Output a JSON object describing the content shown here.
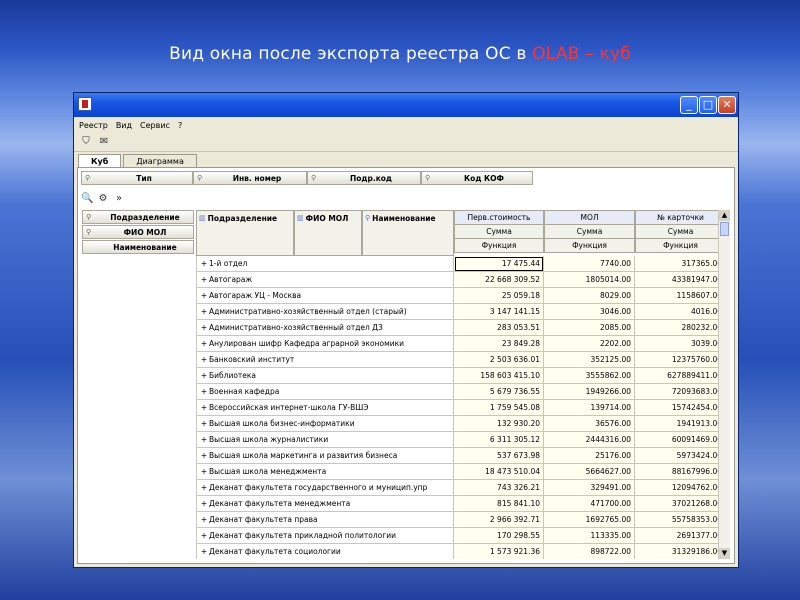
{
  "slide": {
    "title_prefix": "Вид окна после экспорта реестра ОС в ",
    "title_accent": "OLAB – куб",
    "accent_color": "#ff3333"
  },
  "window": {
    "menu": [
      "Реестр",
      "Вид",
      "Сервис",
      "?"
    ],
    "tabs": [
      "Куб",
      "Диаграмма"
    ],
    "column_dims": [
      "Тип",
      "Инв. номер",
      "Подр.код",
      "Код КОФ"
    ],
    "row_dims": [
      "Подразделение",
      "ФИО МОЛ",
      "Наименование"
    ],
    "header": {
      "col1": "Подразделение",
      "col2": "ФИО МОЛ",
      "col3": "Наименование",
      "measures": [
        {
          "name": "Перв.стоимость",
          "agg": "Сумма",
          "fn": "Функция"
        },
        {
          "name": "МОЛ",
          "agg": "Сумма",
          "fn": "Функция"
        },
        {
          "name": "№ карточки",
          "agg": "Сумма",
          "fn": "Функция"
        }
      ]
    },
    "rows": [
      {
        "name": "1-й отдел",
        "v1": "17 475.44",
        "v2": "7740.00",
        "v3": "317365.00"
      },
      {
        "name": "Автогараж",
        "v1": "22 668 309.52",
        "v2": "1805014.00",
        "v3": "43381947.00"
      },
      {
        "name": "Автогараж УЦ - Москва",
        "v1": "25 059.18",
        "v2": "8029.00",
        "v3": "1158607.00"
      },
      {
        "name": "Административно-хозяйственный отдел (старый)",
        "v1": "3 147 141.15",
        "v2": "3046.00",
        "v3": "4016.00"
      },
      {
        "name": "Административно-хозяйственный отдел ДЗ",
        "v1": "283 053.51",
        "v2": "2085.00",
        "v3": "280232.00"
      },
      {
        "name": "Анулирован шифр Кафедра аграрной экономики",
        "v1": "23 849.28",
        "v2": "2202.00",
        "v3": "3039.00"
      },
      {
        "name": "Банковский институт",
        "v1": "2 503 636.01",
        "v2": "352125.00",
        "v3": "12375760.00"
      },
      {
        "name": "Библиотека",
        "v1": "158 603 415.10",
        "v2": "3555862.00",
        "v3": "627889411.00"
      },
      {
        "name": "Военная кафедра",
        "v1": "5 679 736.55",
        "v2": "1949266.00",
        "v3": "72093683.00"
      },
      {
        "name": "Всероссийская интернет-школа ГУ-ВШЭ",
        "v1": "1 759 545.08",
        "v2": "139714.00",
        "v3": "15742454.00"
      },
      {
        "name": "Высшая школа бизнес-информатики",
        "v1": "132 930.20",
        "v2": "36576.00",
        "v3": "1941913.00"
      },
      {
        "name": "Высшая школа журналистики",
        "v1": "6 311 305.12",
        "v2": "2444316.00",
        "v3": "60091469.00"
      },
      {
        "name": "Высшая школа маркетинга и развития бизнеса",
        "v1": "537 673.98",
        "v2": "25176.00",
        "v3": "5973424.00"
      },
      {
        "name": "Высшая школа менеджмента",
        "v1": "18 473 510.04",
        "v2": "5664627.00",
        "v3": "88167996.00"
      },
      {
        "name": "Деканат факультета государственного и муницип.упр",
        "v1": "743 326.21",
        "v2": "329491.00",
        "v3": "12094762.00"
      },
      {
        "name": "Деканат факультета менеджмента",
        "v1": "815 841.10",
        "v2": "471700.00",
        "v3": "37021268.00"
      },
      {
        "name": "Деканат факультета права",
        "v1": "2 966 392.71",
        "v2": "1692765.00",
        "v3": "55758353.00"
      },
      {
        "name": "Деканат факультета прикладной политологии",
        "v1": "170 298.55",
        "v2": "113335.00",
        "v3": "2691377.00"
      },
      {
        "name": "Деканат факультета социологии",
        "v1": "1 573 921.36",
        "v2": "898722.00",
        "v3": "31329186.00"
      }
    ]
  }
}
